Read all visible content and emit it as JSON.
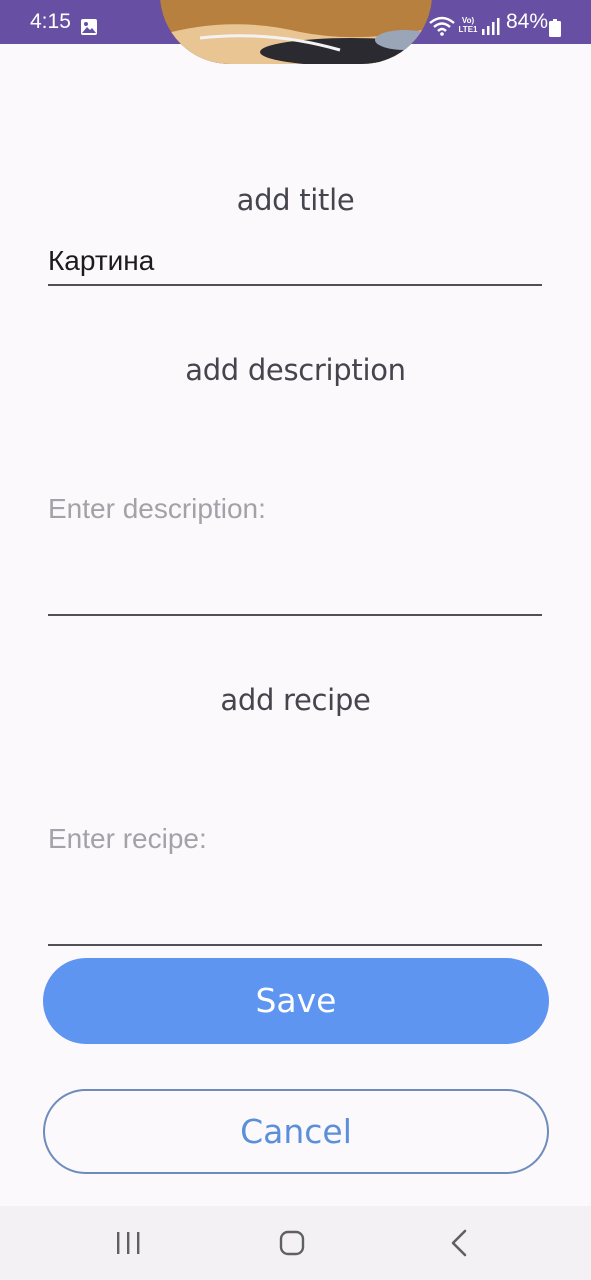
{
  "status_bar": {
    "time": "4:15",
    "network_label": "Vo) LTE1",
    "battery_percent": "84%",
    "background_color": "#6750a4",
    "icons": [
      "gallery-icon",
      "wifi-icon",
      "volte-icon",
      "signal-icon",
      "battery-icon"
    ]
  },
  "recipe_image": {
    "icon": "recipe-photo"
  },
  "title_section": {
    "heading": "add title",
    "value": "Картина"
  },
  "description_section": {
    "heading": "add description",
    "placeholder": "Enter description:"
  },
  "recipe_section": {
    "heading": "add recipe",
    "placeholder": "Enter recipe:"
  },
  "buttons": {
    "save_label": "Save",
    "cancel_label": "Cancel",
    "save_color": "#5d95f1",
    "cancel_text_color": "#5b8fd9"
  },
  "nav_bar": {
    "icons": [
      "recent-apps-icon",
      "home-icon",
      "back-icon"
    ]
  }
}
